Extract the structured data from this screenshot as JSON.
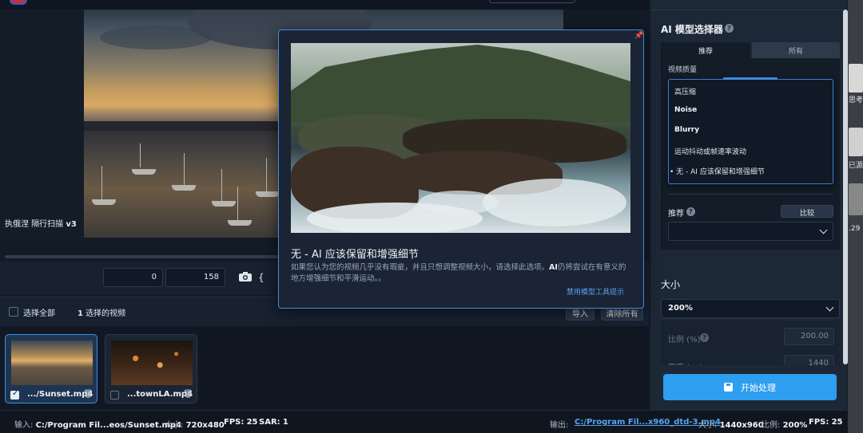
{
  "preview": {
    "overlay_label": "执俄涅 隔行扫描",
    "overlay_label_version": "v3"
  },
  "timeline": {
    "start_value": "0",
    "end_value": "158"
  },
  "selection": {
    "select_all_label": "选择全部",
    "selected_count": "1",
    "selected_suffix": "选择的视频",
    "import_label": "导入",
    "clear_all_label": "清除所有"
  },
  "thumbnails": [
    {
      "name": ".../Sunset.mp4",
      "checked": true
    },
    {
      "name": "...townLA.mp4",
      "checked": false
    }
  ],
  "status": {
    "input_label": "输入:",
    "input_path": "C:/Program Fil...eos/Sunset.mp4",
    "in_size_label": "大小:",
    "in_size": "720x480",
    "fps_label": "FPS:",
    "fps": "25",
    "sar_label": "SAR:",
    "sar": "1",
    "output_label": "输出:",
    "output_path": "C:/Program Fil...x960_dtd-3.mp4",
    "out_size_label": "大小:",
    "out_size": "1440x960",
    "ratio_label": "比例:",
    "ratio": "200%",
    "out_fps_label": "FPS:",
    "out_fps": "25"
  },
  "ai_panel": {
    "title": "AI 模型选择器",
    "tabs": [
      "推荐",
      "所有"
    ],
    "quality_label": "视频质量",
    "quality_options": [
      {
        "label": "高压缩",
        "bold": false
      },
      {
        "label": "Noise",
        "bold": true
      },
      {
        "label": "Blurry",
        "bold": true
      },
      {
        "label": "运动抖动或帧速率波动",
        "bold": false
      },
      {
        "label": "无 - AI 应该保留和增强细节",
        "bold": false,
        "selected": true
      }
    ],
    "recommend_label": "推荐",
    "compare_label": "比较"
  },
  "size_panel": {
    "title": "大小",
    "selected": "200%",
    "ratio_label": "比例 (%)",
    "ratio_value": "200.00",
    "width_label": "宽度 (px)",
    "width_value": "1440"
  },
  "process_label": "开始处理",
  "popup": {
    "title_prefix": "无 - AI",
    "title_suffix": "应该保留和增强细节",
    "desc_part1": "如果您认为您的视频几乎没有瑕疵，并且只想调整视频大小，请选择此选项。",
    "desc_bold": "AI",
    "desc_part2": "仍将尝试在有意义的地方增强细节和平滑运动。。",
    "disable_link": "禁用模型工具提示"
  },
  "desktop": {
    "fragments": [
      "思考",
      "已源",
      ".29"
    ]
  },
  "colors": {
    "accent": "#3f8de0",
    "process_button": "#2d9ef0",
    "panel_bg": "#1d2837"
  }
}
